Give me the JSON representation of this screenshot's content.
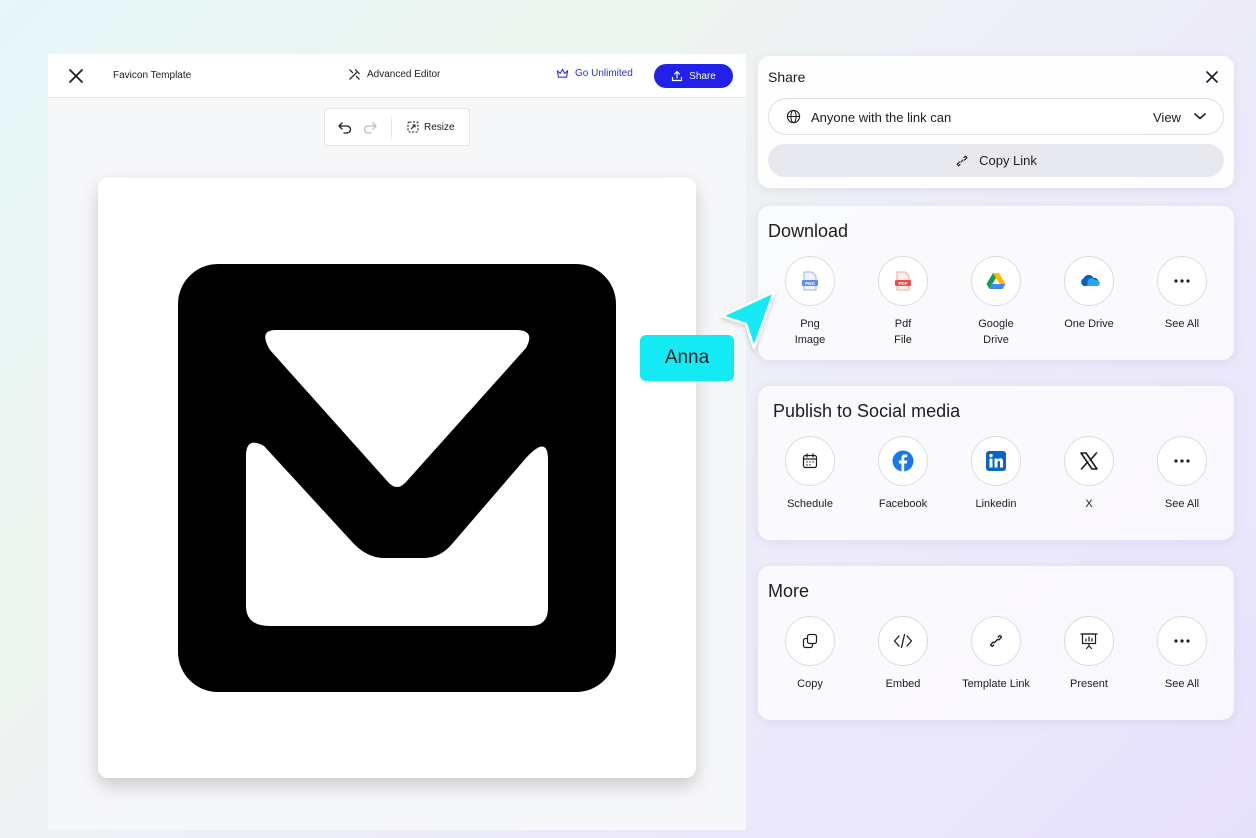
{
  "editor": {
    "title": "Favicon Template",
    "advanced_editor_label": "Advanced Editor",
    "go_unlimited_label": "Go Unlimited",
    "share_label": "Share",
    "resize_label": "Resize"
  },
  "share_panel": {
    "title": "Share",
    "permission_text": "Anyone with the link can",
    "permission_value": "View",
    "copy_link_label": "Copy Link"
  },
  "download": {
    "title": "Download",
    "items": [
      {
        "label": "Png\nImage",
        "icon": "png-file-icon"
      },
      {
        "label": "Pdf\nFile",
        "icon": "pdf-file-icon"
      },
      {
        "label": "Google\nDrive",
        "icon": "google-drive-icon"
      },
      {
        "label": "One Drive",
        "icon": "onedrive-icon"
      },
      {
        "label": "See All",
        "icon": "more-icon"
      }
    ]
  },
  "social": {
    "title": "Publish to Social media",
    "items": [
      {
        "label": "Schedule",
        "icon": "calendar-icon"
      },
      {
        "label": "Facebook",
        "icon": "facebook-icon"
      },
      {
        "label": "Linkedin",
        "icon": "linkedin-icon"
      },
      {
        "label": "X",
        "icon": "x-icon"
      },
      {
        "label": "See All",
        "icon": "more-icon"
      }
    ]
  },
  "more": {
    "title": "More",
    "items": [
      {
        "label": "Copy",
        "icon": "copy-icon"
      },
      {
        "label": "Embed",
        "icon": "code-icon"
      },
      {
        "label": "Template Link",
        "icon": "link-icon"
      },
      {
        "label": "Present",
        "icon": "presentation-icon"
      },
      {
        "label": "See All",
        "icon": "more-icon"
      }
    ]
  },
  "collaborator": {
    "name": "Anna",
    "color": "#14eaf4"
  },
  "colors": {
    "primary": "#2121ea",
    "facebook": "#1877f2",
    "linkedin": "#0a66c2"
  }
}
